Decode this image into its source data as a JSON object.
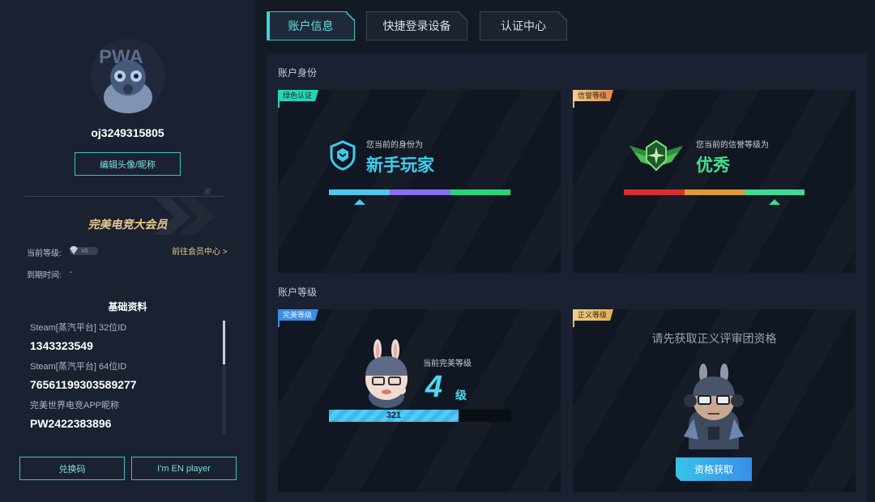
{
  "profile": {
    "username": "oj3249315805",
    "edit_label": "编辑头像/昵称",
    "member_title": "完美电竞大会员",
    "level_label": "当前等级:",
    "level_badge": "V0",
    "member_link": "前往会员中心 >",
    "expire_label": "到期时间:",
    "expire_value": "-"
  },
  "basic_info": {
    "title": "基础资料",
    "items": [
      {
        "label": "Steam[蒸汽平台] 32位ID",
        "value": "1343323549"
      },
      {
        "label": "Steam[蒸汽平台] 64位ID",
        "value": "76561199303589277"
      },
      {
        "label": "完美世界电竞APP昵称",
        "value": "PW2422383896"
      }
    ]
  },
  "sidebar_buttons": {
    "redeem": "兑换码",
    "en_player": "I'm EN player"
  },
  "tabs": [
    {
      "label": "账户信息",
      "active": true
    },
    {
      "label": "快捷登录设备",
      "active": false
    },
    {
      "label": "认证中心",
      "active": false
    }
  ],
  "identity_section": {
    "heading": "账户身份",
    "identity_card": {
      "tag": "绿色认证",
      "caption": "您当前的身份为",
      "value": "新手玩家",
      "marker_position": 0.17
    },
    "credit_card": {
      "tag": "信誉等级",
      "caption": "您当前的信誉等级为",
      "value": "优秀",
      "marker_position": 0.83
    }
  },
  "level_section": {
    "heading": "账户等级",
    "perfect_card": {
      "tag": "完美等级",
      "caption": "当前完美等级",
      "level": "4",
      "unit": "级",
      "xp": "321",
      "xp_progress": 0.71
    },
    "justice_card": {
      "tag": "正义等级",
      "prompt": "请先获取正义评审团资格",
      "button": "资格获取"
    }
  },
  "colors": {
    "accent": "#3fbfc4",
    "gold": "#e9c98b",
    "identity_bar": [
      "#4dc8ee",
      "#8a6ff0",
      "#27d67a"
    ],
    "credit_bar": [
      "#d63030",
      "#e29a34",
      "#3ddc97"
    ]
  }
}
